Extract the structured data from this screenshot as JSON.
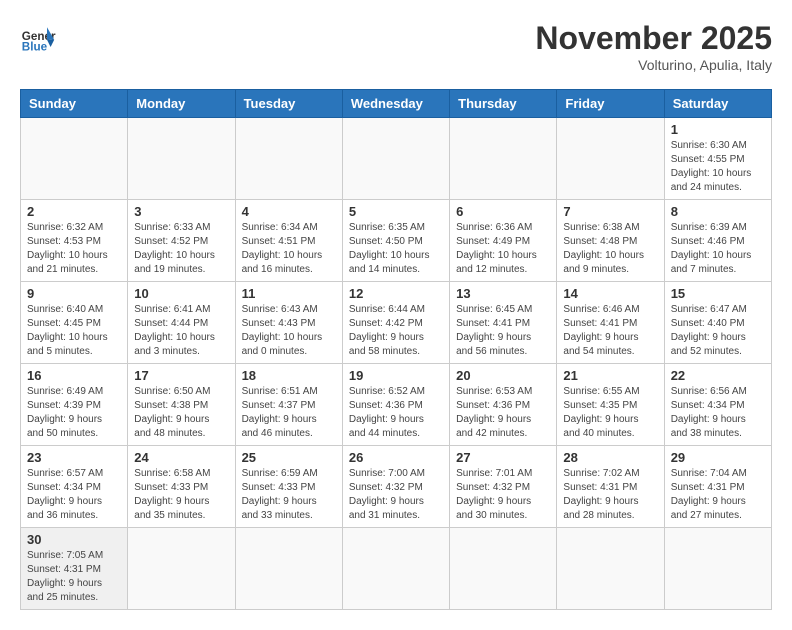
{
  "header": {
    "logo_general": "General",
    "logo_blue": "Blue",
    "month_title": "November 2025",
    "subtitle": "Volturino, Apulia, Italy"
  },
  "days_of_week": [
    "Sunday",
    "Monday",
    "Tuesday",
    "Wednesday",
    "Thursday",
    "Friday",
    "Saturday"
  ],
  "weeks": [
    [
      {
        "day": "",
        "info": ""
      },
      {
        "day": "",
        "info": ""
      },
      {
        "day": "",
        "info": ""
      },
      {
        "day": "",
        "info": ""
      },
      {
        "day": "",
        "info": ""
      },
      {
        "day": "",
        "info": ""
      },
      {
        "day": "1",
        "info": "Sunrise: 6:30 AM\nSunset: 4:55 PM\nDaylight: 10 hours and 24 minutes."
      }
    ],
    [
      {
        "day": "2",
        "info": "Sunrise: 6:32 AM\nSunset: 4:53 PM\nDaylight: 10 hours and 21 minutes."
      },
      {
        "day": "3",
        "info": "Sunrise: 6:33 AM\nSunset: 4:52 PM\nDaylight: 10 hours and 19 minutes."
      },
      {
        "day": "4",
        "info": "Sunrise: 6:34 AM\nSunset: 4:51 PM\nDaylight: 10 hours and 16 minutes."
      },
      {
        "day": "5",
        "info": "Sunrise: 6:35 AM\nSunset: 4:50 PM\nDaylight: 10 hours and 14 minutes."
      },
      {
        "day": "6",
        "info": "Sunrise: 6:36 AM\nSunset: 4:49 PM\nDaylight: 10 hours and 12 minutes."
      },
      {
        "day": "7",
        "info": "Sunrise: 6:38 AM\nSunset: 4:48 PM\nDaylight: 10 hours and 9 minutes."
      },
      {
        "day": "8",
        "info": "Sunrise: 6:39 AM\nSunset: 4:46 PM\nDaylight: 10 hours and 7 minutes."
      }
    ],
    [
      {
        "day": "9",
        "info": "Sunrise: 6:40 AM\nSunset: 4:45 PM\nDaylight: 10 hours and 5 minutes."
      },
      {
        "day": "10",
        "info": "Sunrise: 6:41 AM\nSunset: 4:44 PM\nDaylight: 10 hours and 3 minutes."
      },
      {
        "day": "11",
        "info": "Sunrise: 6:43 AM\nSunset: 4:43 PM\nDaylight: 10 hours and 0 minutes."
      },
      {
        "day": "12",
        "info": "Sunrise: 6:44 AM\nSunset: 4:42 PM\nDaylight: 9 hours and 58 minutes."
      },
      {
        "day": "13",
        "info": "Sunrise: 6:45 AM\nSunset: 4:41 PM\nDaylight: 9 hours and 56 minutes."
      },
      {
        "day": "14",
        "info": "Sunrise: 6:46 AM\nSunset: 4:41 PM\nDaylight: 9 hours and 54 minutes."
      },
      {
        "day": "15",
        "info": "Sunrise: 6:47 AM\nSunset: 4:40 PM\nDaylight: 9 hours and 52 minutes."
      }
    ],
    [
      {
        "day": "16",
        "info": "Sunrise: 6:49 AM\nSunset: 4:39 PM\nDaylight: 9 hours and 50 minutes."
      },
      {
        "day": "17",
        "info": "Sunrise: 6:50 AM\nSunset: 4:38 PM\nDaylight: 9 hours and 48 minutes."
      },
      {
        "day": "18",
        "info": "Sunrise: 6:51 AM\nSunset: 4:37 PM\nDaylight: 9 hours and 46 minutes."
      },
      {
        "day": "19",
        "info": "Sunrise: 6:52 AM\nSunset: 4:36 PM\nDaylight: 9 hours and 44 minutes."
      },
      {
        "day": "20",
        "info": "Sunrise: 6:53 AM\nSunset: 4:36 PM\nDaylight: 9 hours and 42 minutes."
      },
      {
        "day": "21",
        "info": "Sunrise: 6:55 AM\nSunset: 4:35 PM\nDaylight: 9 hours and 40 minutes."
      },
      {
        "day": "22",
        "info": "Sunrise: 6:56 AM\nSunset: 4:34 PM\nDaylight: 9 hours and 38 minutes."
      }
    ],
    [
      {
        "day": "23",
        "info": "Sunrise: 6:57 AM\nSunset: 4:34 PM\nDaylight: 9 hours and 36 minutes."
      },
      {
        "day": "24",
        "info": "Sunrise: 6:58 AM\nSunset: 4:33 PM\nDaylight: 9 hours and 35 minutes."
      },
      {
        "day": "25",
        "info": "Sunrise: 6:59 AM\nSunset: 4:33 PM\nDaylight: 9 hours and 33 minutes."
      },
      {
        "day": "26",
        "info": "Sunrise: 7:00 AM\nSunset: 4:32 PM\nDaylight: 9 hours and 31 minutes."
      },
      {
        "day": "27",
        "info": "Sunrise: 7:01 AM\nSunset: 4:32 PM\nDaylight: 9 hours and 30 minutes."
      },
      {
        "day": "28",
        "info": "Sunrise: 7:02 AM\nSunset: 4:31 PM\nDaylight: 9 hours and 28 minutes."
      },
      {
        "day": "29",
        "info": "Sunrise: 7:04 AM\nSunset: 4:31 PM\nDaylight: 9 hours and 27 minutes."
      }
    ],
    [
      {
        "day": "30",
        "info": "Sunrise: 7:05 AM\nSunset: 4:31 PM\nDaylight: 9 hours and 25 minutes."
      },
      {
        "day": "",
        "info": ""
      },
      {
        "day": "",
        "info": ""
      },
      {
        "day": "",
        "info": ""
      },
      {
        "day": "",
        "info": ""
      },
      {
        "day": "",
        "info": ""
      },
      {
        "day": "",
        "info": ""
      }
    ]
  ]
}
